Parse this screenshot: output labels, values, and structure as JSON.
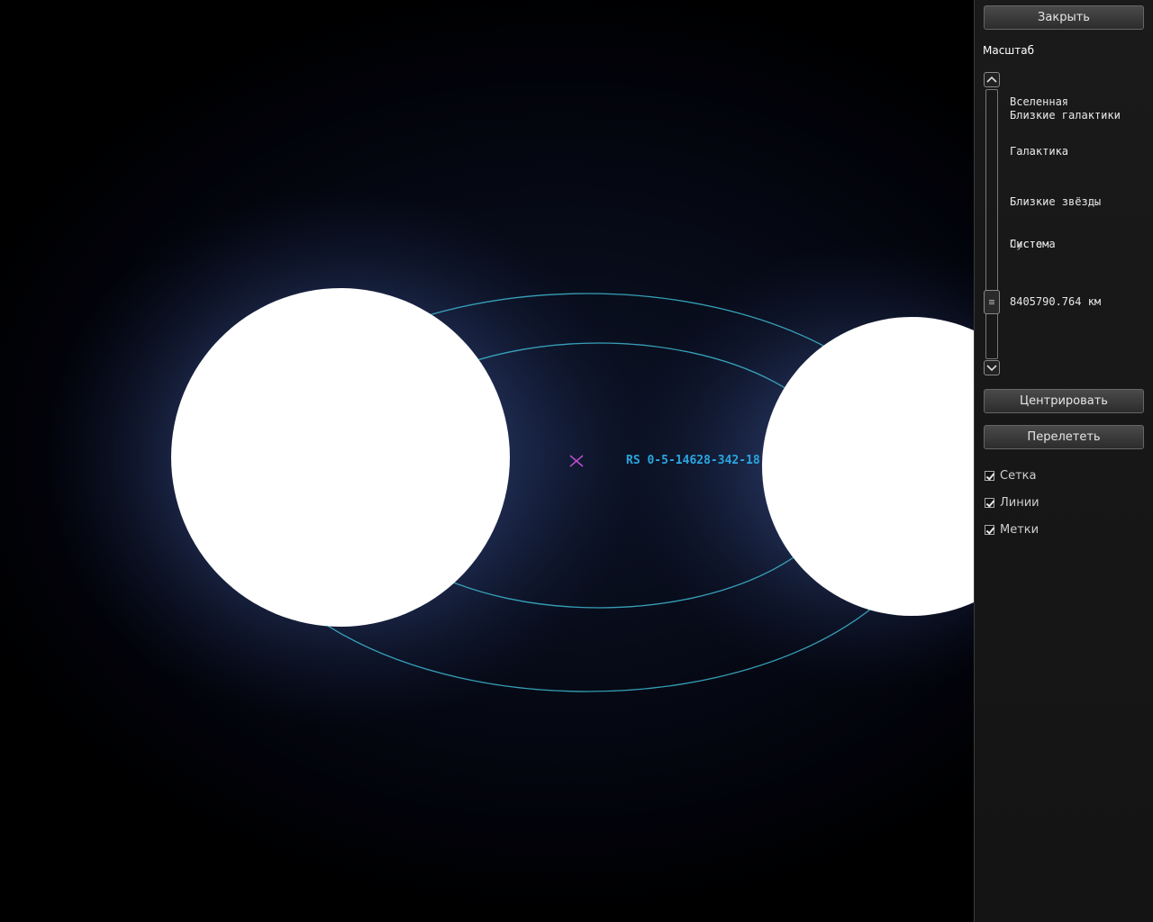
{
  "viewport": {
    "target_label": "RS 0-5-14628-342-18"
  },
  "panel": {
    "close_label": "Закрыть",
    "scale_title": "Масштаб",
    "levels": [
      "Вселенная",
      "Близкие галактики",
      "Галактика",
      "Близкие звёзды",
      "Система",
      "Пусто"
    ],
    "distance": "8405790.764 км",
    "center_label": "Центрировать",
    "fly_label": "Перелететь",
    "toggles": [
      {
        "label": "Сетка",
        "checked": true
      },
      {
        "label": "Линии",
        "checked": true
      },
      {
        "label": "Метки",
        "checked": true
      }
    ]
  },
  "colors": {
    "orbit": "#3bb0c8",
    "label": "#2aa6e0",
    "marker": "#c050d0",
    "star_glow": "#5a78c8"
  }
}
